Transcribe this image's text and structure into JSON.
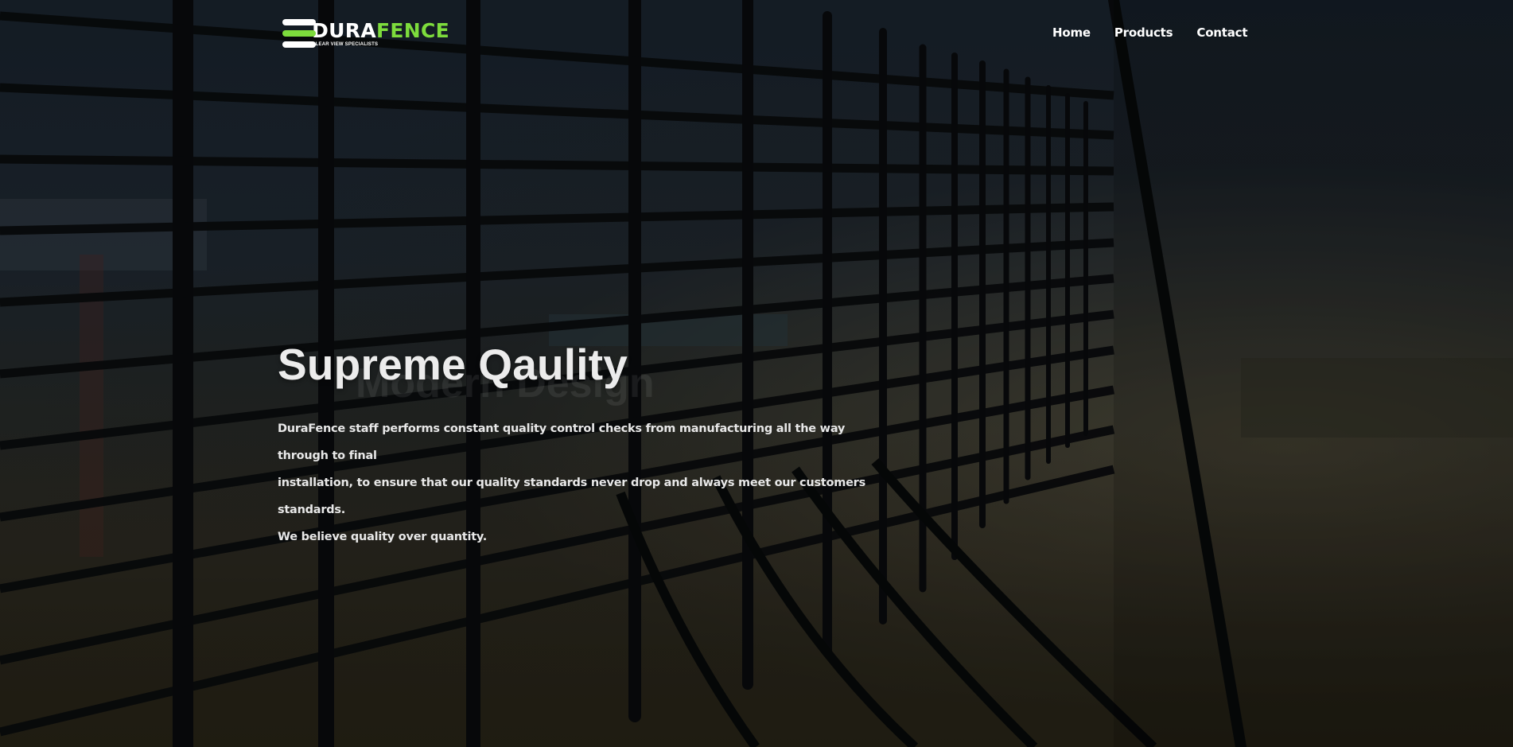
{
  "brand": {
    "name_part1": "DURA",
    "name_part2": "FENCE",
    "tagline": "CLEAR VIEW SPECIALISTS",
    "accent_color": "#7ddc3c"
  },
  "nav": {
    "items": [
      {
        "label": "Home"
      },
      {
        "label": "Products"
      },
      {
        "label": "Contact"
      }
    ]
  },
  "hero": {
    "title": "Supreme Qaulity",
    "paragraph_lines": [
      "DuraFence staff performs constant quality control checks from manufacturing all the way through to final",
      "installation, to ensure that our quality standards never drop and always meet our customers standards.",
      "We believe quality over quantity."
    ],
    "ghost_title": "Modern Design"
  }
}
